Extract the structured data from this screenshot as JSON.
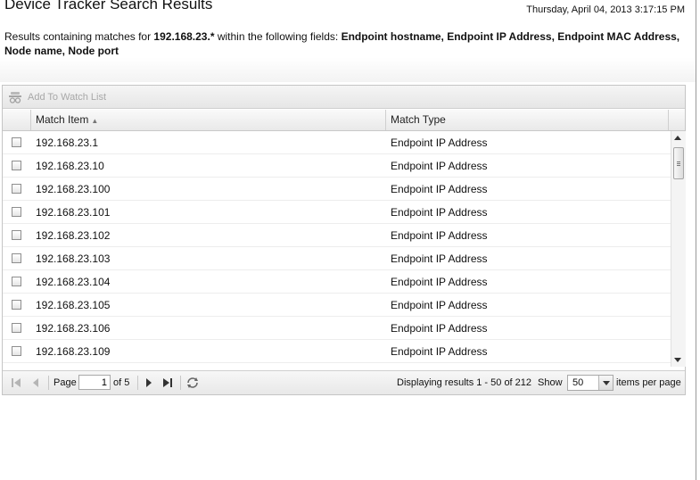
{
  "header": {
    "title": "Device Tracker Search Results",
    "timestamp": "Thursday, April 04, 2013 3:17:15 PM",
    "summary_prefix": "Results containing matches for ",
    "search_term": "192.168.23.*",
    "summary_mid": " within the following fields: ",
    "fields": "Endpoint hostname, Endpoint IP Address, Endpoint MAC Address, Node name, Node port"
  },
  "toolbar": {
    "add_watch_label": "Add To Watch List"
  },
  "columns": {
    "match_item": "Match Item",
    "match_type": "Match Type"
  },
  "rows": [
    {
      "item": "192.168.23.1",
      "type": "Endpoint IP Address"
    },
    {
      "item": "192.168.23.10",
      "type": "Endpoint IP Address"
    },
    {
      "item": "192.168.23.100",
      "type": "Endpoint IP Address"
    },
    {
      "item": "192.168.23.101",
      "type": "Endpoint IP Address"
    },
    {
      "item": "192.168.23.102",
      "type": "Endpoint IP Address"
    },
    {
      "item": "192.168.23.103",
      "type": "Endpoint IP Address"
    },
    {
      "item": "192.168.23.104",
      "type": "Endpoint IP Address"
    },
    {
      "item": "192.168.23.105",
      "type": "Endpoint IP Address"
    },
    {
      "item": "192.168.23.106",
      "type": "Endpoint IP Address"
    },
    {
      "item": "192.168.23.109",
      "type": "Endpoint IP Address"
    }
  ],
  "pager": {
    "page_label": "Page",
    "current_page": "1",
    "of_label": "of 5",
    "display_text": "Displaying results 1 - 50 of 212",
    "show_label": "Show",
    "page_size": "50",
    "per_page_label": "items per page"
  }
}
